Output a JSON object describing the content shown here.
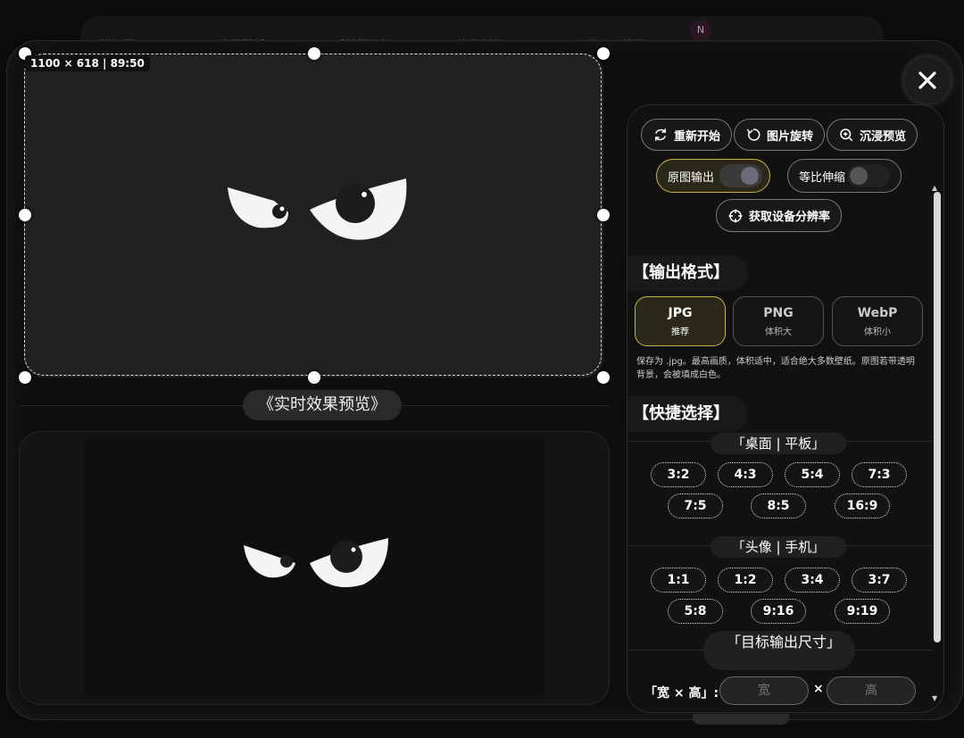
{
  "background_tabs": [
    "附加图",
    "全屏壁纸",
    "壁纸测试",
    "头像制作",
    "证件与二维码"
  ],
  "background_badge": "N",
  "dimensions_label": "1100 × 618 | 89:50",
  "preview_title": "《实时效果预览》",
  "toolbar": {
    "restart": "重新开始",
    "rotate": "图片旋转",
    "immersive": "沉浸预览",
    "original_output": "原图输出",
    "proportional": "等比伸缩",
    "device_resolution": "获取设备分辨率"
  },
  "output_format": {
    "heading": "【输出格式】",
    "options": [
      {
        "name": "JPG",
        "desc": "推荐",
        "selected": true
      },
      {
        "name": "PNG",
        "desc": "体积大",
        "selected": false
      },
      {
        "name": "WebP",
        "desc": "体积小",
        "selected": false
      }
    ],
    "description": "保存为 .jpg。最高画质，体积适中，适合绝大多数壁纸。原图若带透明背景，会被填成白色。"
  },
  "quick_select": {
    "heading": "【快捷选择】",
    "desktop_label": "「桌面 | 平板」",
    "desktop_ratios": [
      "3:2",
      "4:3",
      "5:4",
      "7:3",
      "7:5",
      "8:5",
      "16:9"
    ],
    "avatar_label": "「头像 | 手机」",
    "avatar_ratios": [
      "1:1",
      "1:2",
      "3:4",
      "3:7",
      "5:8",
      "9:16",
      "9:19"
    ]
  },
  "target_size": {
    "heading": "「目标输出尺寸」",
    "label": "「宽 × 高」:",
    "width_placeholder": "宽",
    "height_placeholder": "高",
    "times": "×"
  },
  "colors": {
    "accent": "#c9b34a",
    "panel": "#111111",
    "canvas": "#212120"
  },
  "icons": [
    "close-icon",
    "refresh-icon",
    "rotate-icon",
    "zoom-in-icon",
    "crosshair-icon"
  ]
}
